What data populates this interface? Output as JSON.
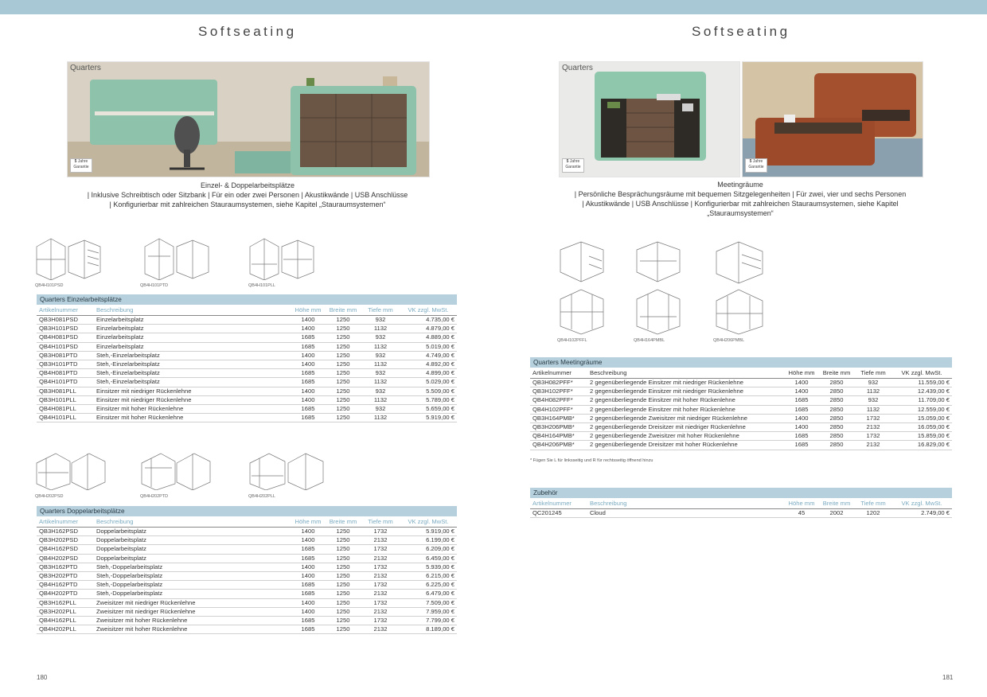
{
  "left": {
    "title": "Softseating",
    "photo": {
      "label": "Quarters",
      "badge_num": "5",
      "badge_unit": "Jahre",
      "badge_text": "Garantie"
    },
    "caption": [
      "Einzel- & Doppelarbeitsplätze",
      "| Inklusive Schreibtisch oder Sitzbank | Für ein oder zwei Personen | Akustikwände | USB Anschlüsse",
      "| Konfigurierbar mit zahlreichen Stauraumsystemen, siehe Kapitel „Stauraumsystemen“"
    ],
    "drawings_top": [
      "QB4H101PSD",
      "QB4H101PTD",
      "QB4H101PLL"
    ],
    "drawings_mid": [
      "QB4H202PSD",
      "QB4H202PTD",
      "QB4H202PLL"
    ],
    "table1": {
      "title": "Quarters Einzelarbeitsplätze",
      "headers": [
        "Artikelnummer",
        "Beschreibung",
        "Höhe mm",
        "Breite mm",
        "Tiefe mm",
        "VK zzgl. MwSt."
      ],
      "rows": [
        [
          "QB3H081PSD",
          "Einzelarbeitsplatz",
          "1400",
          "1250",
          "932",
          "4.735,00 €"
        ],
        [
          "QB3H101PSD",
          "Einzelarbeitsplatz",
          "1400",
          "1250",
          "1132",
          "4.879,00 €"
        ],
        [
          "QB4H081PSD",
          "Einzelarbeitsplatz",
          "1685",
          "1250",
          "932",
          "4.889,00 €"
        ],
        [
          "QB4H101PSD",
          "Einzelarbeitsplatz",
          "1685",
          "1250",
          "1132",
          "5.019,00 €"
        ],
        [
          "QB3H081PTD",
          "Steh,-Einzelarbeitsplatz",
          "1400",
          "1250",
          "932",
          "4.749,00 €"
        ],
        [
          "QB3H101PTD",
          "Steh,-Einzelarbeitsplatz",
          "1400",
          "1250",
          "1132",
          "4.892,00 €"
        ],
        [
          "QB4H081PTD",
          "Steh,-Einzelarbeitsplatz",
          "1685",
          "1250",
          "932",
          "4.899,00 €"
        ],
        [
          "QB4H101PTD",
          "Steh,-Einzelarbeitsplatz",
          "1685",
          "1250",
          "1132",
          "5.029,00 €"
        ],
        [
          "QB3H081PLL",
          "Einsitzer mit niedriger Rückenlehne",
          "1400",
          "1250",
          "932",
          "5.509,00 €"
        ],
        [
          "QB3H101PLL",
          "Einsitzer mit niedriger Rückenlehne",
          "1400",
          "1250",
          "1132",
          "5.789,00 €"
        ],
        [
          "QB4H081PLL",
          "Einsitzer mit hoher Rückenlehne",
          "1685",
          "1250",
          "932",
          "5.659,00 €"
        ],
        [
          "QB4H101PLL",
          "Einsitzer mit hoher Rückenlehne",
          "1685",
          "1250",
          "1132",
          "5.919,00 €"
        ]
      ]
    },
    "table2": {
      "title": "Quarters Doppelarbeitsplätze",
      "headers": [
        "Artikelnummer",
        "Beschreibung",
        "Höhe mm",
        "Breite mm",
        "Tiefe mm",
        "VK zzgl. MwSt."
      ],
      "rows": [
        [
          "QB3H162PSD",
          "Doppelarbeitsplatz",
          "1400",
          "1250",
          "1732",
          "5.919,00 €"
        ],
        [
          "QB3H202PSD",
          "Doppelarbeitsplatz",
          "1400",
          "1250",
          "2132",
          "6.199,00 €"
        ],
        [
          "QB4H162PSD",
          "Doppelarbeitsplatz",
          "1685",
          "1250",
          "1732",
          "6.209,00 €"
        ],
        [
          "QB4H202PSD",
          "Doppelarbeitsplatz",
          "1685",
          "1250",
          "2132",
          "6.459,00 €"
        ],
        [
          "QB3H162PTD",
          "Steh,-Doppelarbeitsplatz",
          "1400",
          "1250",
          "1732",
          "5.939,00 €"
        ],
        [
          "QB3H202PTD",
          "Steh,-Doppelarbeitsplatz",
          "1400",
          "1250",
          "2132",
          "6.215,00 €"
        ],
        [
          "QB4H162PTD",
          "Steh,-Doppelarbeitsplatz",
          "1685",
          "1250",
          "1732",
          "6.225,00 €"
        ],
        [
          "QB4H202PTD",
          "Steh,-Doppelarbeitsplatz",
          "1685",
          "1250",
          "2132",
          "6.479,00 €"
        ],
        [
          "QB3H162PLL",
          "Zweisitzer mit niedriger Rückenlehne",
          "1400",
          "1250",
          "1732",
          "7.509,00 €"
        ],
        [
          "QB3H202PLL",
          "Zweisitzer mit niedriger Rückenlehne",
          "1400",
          "1250",
          "2132",
          "7.959,00 €"
        ],
        [
          "QB4H162PLL",
          "Zweisitzer mit hoher Rückenlehne",
          "1685",
          "1250",
          "1732",
          "7.799,00 €"
        ],
        [
          "QB4H202PLL",
          "Zweisitzer mit hoher Rückenlehne",
          "1685",
          "1250",
          "2132",
          "8.189,00 €"
        ]
      ]
    },
    "page_number": "180"
  },
  "right": {
    "title": "Softseating",
    "photo1": {
      "label": "Quarters",
      "badge_num": "5",
      "badge_unit": "Jahre",
      "badge_text": "Garantie"
    },
    "photo2": {
      "badge_num": "5",
      "badge_unit": "Jahre",
      "badge_text": "Garantie"
    },
    "caption": [
      "Meetingräume",
      "| Persönliche Besprächungsräume mit bequemen Sitzgelegenheiten | Für zwei, vier und sechs Personen",
      "| Akustikwände | USB Anschlüsse | Konfigurierbar mit zahlreichen Stauraumsystemen, siehe Kapitel",
      "„Stauraumsystemen“"
    ],
    "drawings": [
      "QB4H102PFFL",
      "QB4H164PMBL",
      "QB4H206PMBL"
    ],
    "table1": {
      "title": "Quarters Meetingräume",
      "headers": [
        "Artikelnummer",
        "Beschreibung",
        "Höhe mm",
        "Breite mm",
        "Tiefe mm",
        "VK zzgl. MwSt."
      ],
      "rows": [
        [
          "QB3H082PFF*",
          "2 gegenüberliegende Einsitzer mit niedriger Rückenlehne",
          "1400",
          "2850",
          "932",
          "11.559,00 €"
        ],
        [
          "QB3H102PFF*",
          "2 gegenüberliegende Einsitzer mit niedriger Rückenlehne",
          "1400",
          "2850",
          "1132",
          "12.439,00 €"
        ],
        [
          "QB4H082PFF*",
          "2 gegenüberliegende Einsitzer mit hoher Rückenlehne",
          "1685",
          "2850",
          "932",
          "11.709,00 €"
        ],
        [
          "QB4H102PFF*",
          "2 gegenüberliegende Einsitzer mit hoher Rückenlehne",
          "1685",
          "2850",
          "1132",
          "12.559,00 €"
        ],
        [
          "QB3H164PMB*",
          "2 gegenüberliegende Zweisitzer mit niedriger Rückenlehne",
          "1400",
          "2850",
          "1732",
          "15.059,00 €"
        ],
        [
          "QB3H206PMB*",
          "2 gegenüberliegende Dreisitzer mit niedriger Rückenlehne",
          "1400",
          "2850",
          "2132",
          "16.059,00 €"
        ],
        [
          "QB4H164PMB*",
          "2 gegenüberliegende Zweisitzer mit hoher Rückenlehne",
          "1685",
          "2850",
          "1732",
          "15.859,00 €"
        ],
        [
          "QB4H206PMB*",
          "2 gegenüberliegende Dreisitzer mit hoher Rückenlehne",
          "1685",
          "2850",
          "2132",
          "16.829,00 €"
        ]
      ]
    },
    "note": "* Fügen Sie L für linksseitig und R für rechtsseitig öffnend hinzu",
    "table2": {
      "title": "Zubehör",
      "headers": [
        "Artikelnummer",
        "Beschreibung",
        "Höhe mm",
        "Breite mm",
        "Tiefe mm",
        "VK zzgl. MwSt."
      ],
      "rows": [
        [
          "QC201245",
          "Cloud",
          "45",
          "2002",
          "1202",
          "2.749,00 €"
        ]
      ]
    },
    "page_number": "181"
  }
}
